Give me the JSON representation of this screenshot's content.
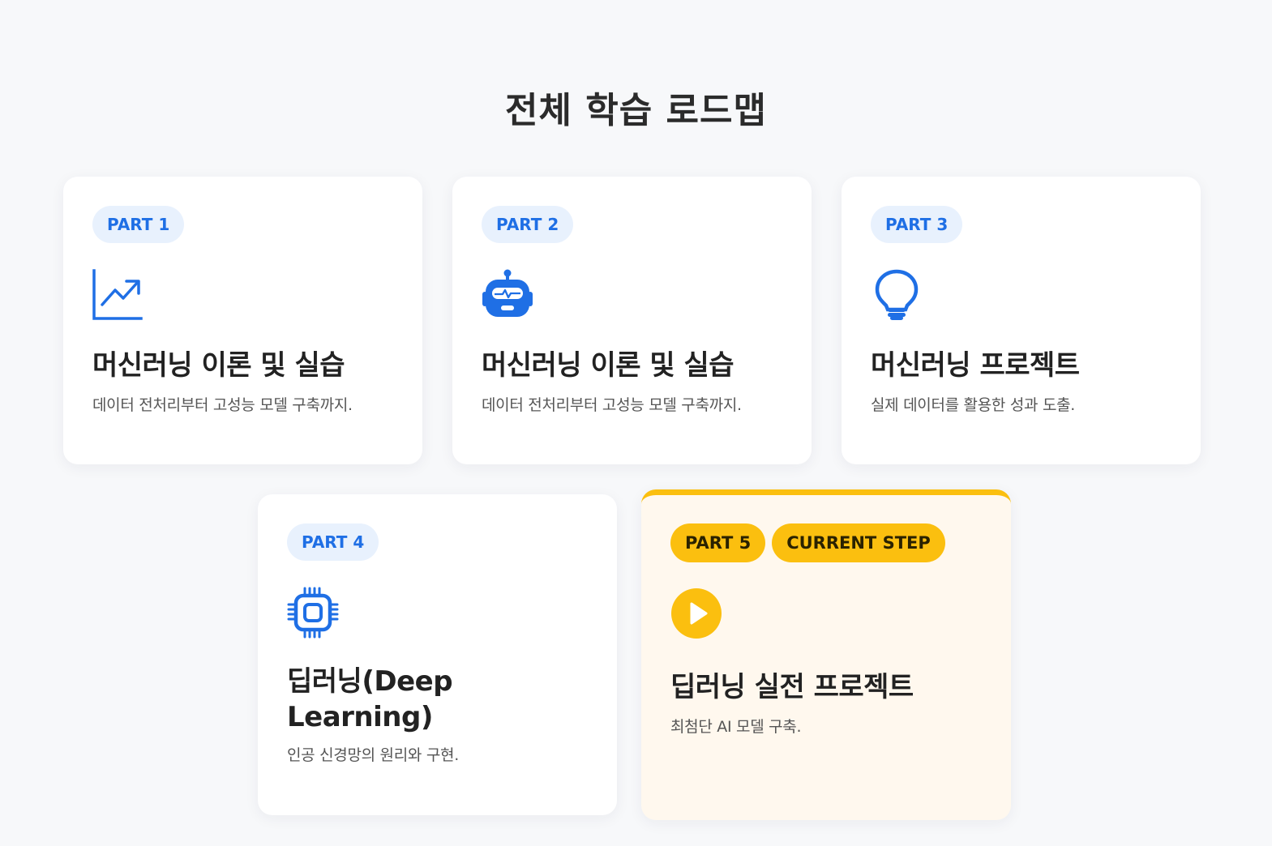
{
  "page": {
    "title": "전체 학습 로드맵"
  },
  "colors": {
    "accent": "#1f6fe5",
    "badge_bg": "#e8f1fd",
    "current": "#fbbf0f",
    "current_bg": "#fff8ee"
  },
  "cards": [
    {
      "part": "PART 1",
      "icon": "chart-line-icon",
      "title": "머신러닝 이론 및 실습",
      "desc": "데이터 전처리부터 고성능 모델 구축까지."
    },
    {
      "part": "PART 2",
      "icon": "robot-icon",
      "title": "머신러닝 이론 및 실습",
      "desc": "데이터 전처리부터 고성능 모델 구축까지."
    },
    {
      "part": "PART 3",
      "icon": "lightbulb-icon",
      "title": "머신러닝 프로젝트",
      "desc": "실제 데이터를 활용한 성과 도출."
    },
    {
      "part": "PART 4",
      "icon": "chip-icon",
      "title": "딥러닝(Deep Learning)",
      "desc": "인공 신경망의 원리와 구현."
    },
    {
      "part": "PART 5",
      "status": "CURRENT STEP",
      "icon": "play-icon",
      "title": "딥러닝 실전 프로젝트",
      "desc": "최첨단 AI 모델 구축."
    }
  ]
}
